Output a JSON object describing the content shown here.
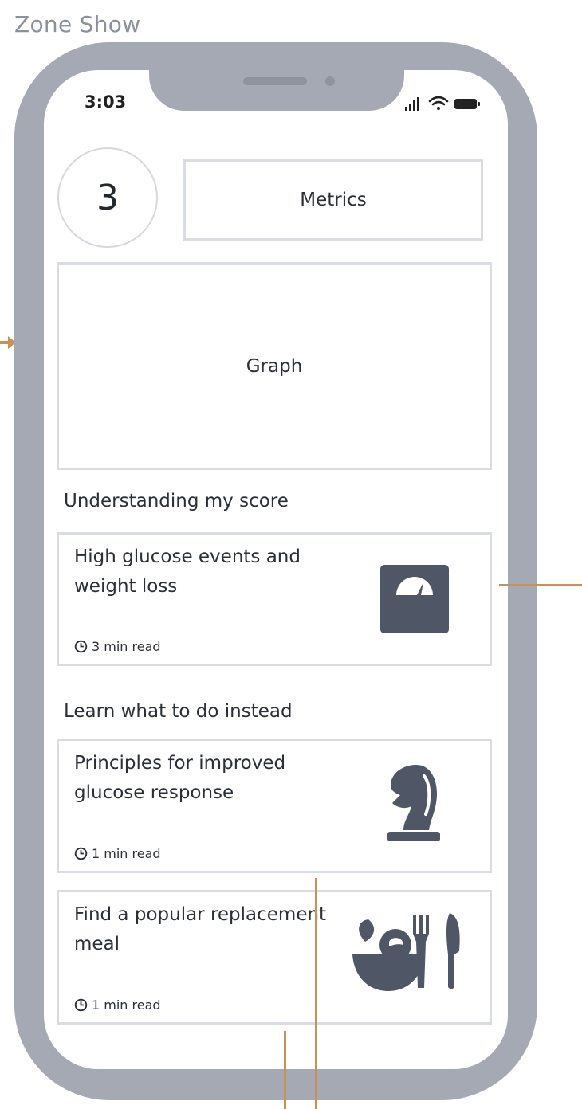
{
  "board": {
    "title": "Zone Show"
  },
  "status_bar": {
    "time": "3:03"
  },
  "score": {
    "value": "3"
  },
  "metrics": {
    "label": "Metrics"
  },
  "graph": {
    "label": "Graph"
  },
  "sections": [
    {
      "title": "Understanding my score",
      "cards": [
        {
          "title": "High glucose events and weight loss",
          "meta": "3 min read",
          "icon": "scale-icon"
        }
      ]
    },
    {
      "title": "Learn what to do instead",
      "cards": [
        {
          "title": "Principles for improved glucose response",
          "meta": "1 min read",
          "icon": "chess-knight-icon"
        },
        {
          "title": "Find a popular replacement meal",
          "meta": "1 min read",
          "icon": "meal-icon"
        }
      ]
    }
  ],
  "colors": {
    "phone_frame": "#a4a9b3",
    "connector": "#c8905a",
    "icon": "#4f5766",
    "border": "#d9dde3"
  }
}
